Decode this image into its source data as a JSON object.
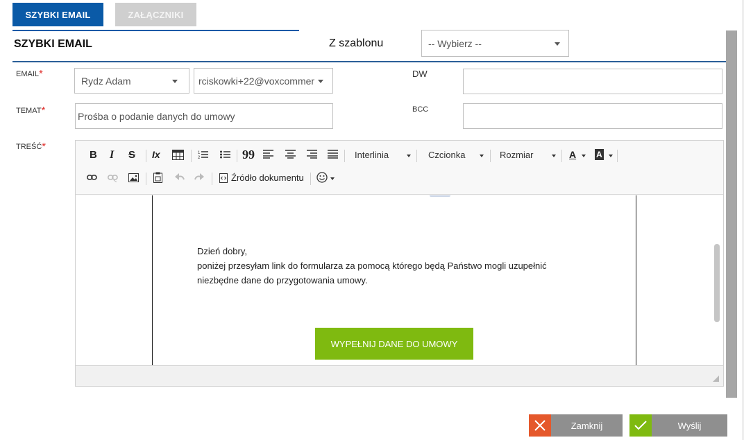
{
  "tabs": [
    {
      "label": "SZYBKI EMAIL",
      "active": true
    },
    {
      "label": "ZAŁĄCZNIKI",
      "active": false
    }
  ],
  "section": {
    "title": "SZYBKI EMAIL"
  },
  "template": {
    "label": "Z szablonu",
    "select_value": "-- Wybierz --"
  },
  "fields": {
    "email": {
      "label": "EMAIL",
      "required_mark": "*",
      "contact_value": "Rydz Adam",
      "address_value": "rciskowki+22@voxcommer"
    },
    "dw": {
      "label": "DW",
      "value": ""
    },
    "temat": {
      "label": "TEMAT",
      "required_mark": "*",
      "value": "Prośba o podanie danych do umowy"
    },
    "bcc": {
      "label": "BCC",
      "value": ""
    },
    "tresc": {
      "label": "TREŚĆ",
      "required_mark": "*"
    }
  },
  "toolbar": {
    "bold": "B",
    "italic": "I",
    "strike": "S",
    "clear_format": "Ix",
    "blockquote": "99",
    "line_height": "Interlinia",
    "font": "Czcionka",
    "size": "Rozmiar",
    "text_color": "A",
    "bg_color": "A",
    "source": "Źródło dokumentu"
  },
  "email_body": {
    "line1": "Dzień dobry,",
    "line2": "poniżej przesyłam link do formularza za pomocą którego będą Państwo mogli uzupełnić",
    "line3": "niezbędne dane do przygotowania umowy.",
    "cta": "WYPEŁNIJ DANE DO UMOWY"
  },
  "buttons": {
    "close": "Zamknij",
    "send": "Wyślij"
  },
  "colors": {
    "primary": "#0a5aa7",
    "required": "#e0322f",
    "cta_green": "#7fba10",
    "close_orange": "#e5582b"
  }
}
